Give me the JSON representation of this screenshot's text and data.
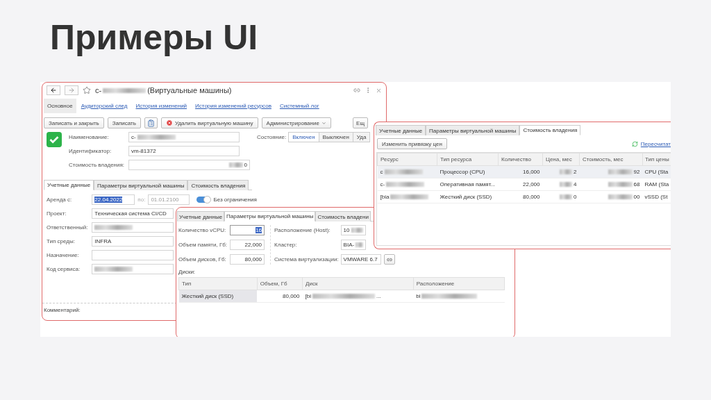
{
  "slide_title": "Примеры UI",
  "main_form": {
    "title": {
      "pre": "c-",
      "masked": true,
      "post": " (Виртуальные машины)"
    },
    "nav": [
      {
        "label": "Основное",
        "selected": true
      },
      {
        "label": "Аудиторский след",
        "selected": false
      },
      {
        "label": "История изменений",
        "selected": false
      },
      {
        "label": "История изменений ресурсов",
        "selected": false
      },
      {
        "label": "Системный лог",
        "selected": false
      }
    ],
    "toolbar": [
      {
        "kind": "button",
        "label": "Записать и закрыть"
      },
      {
        "kind": "button",
        "label": "Записать"
      },
      {
        "kind": "icon"
      },
      {
        "kind": "danger",
        "label": "Удалить виртуальную машину"
      },
      {
        "kind": "menu",
        "label": "Администрирование"
      },
      {
        "kind": "button",
        "label": "Ещ"
      }
    ],
    "fields": [
      {
        "label": "Наименование:",
        "value": {
          "pre": "c-",
          "masked": true
        }
      },
      {
        "label": "Идентификатор:",
        "value": {
          "pre": "vm-81372"
        }
      },
      {
        "label": "Стоимость владения:",
        "value": {
          "masked": true,
          "post": "0"
        },
        "numeric": true
      }
    ],
    "state": {
      "label": "Состояние:",
      "options": [
        {
          "label": "Включен",
          "selected": true
        },
        {
          "label": "Выключен",
          "selected": false
        },
        {
          "label": "Уда",
          "selected": false
        }
      ]
    },
    "tabs": [
      {
        "label": "Учетные данные",
        "selected": true
      },
      {
        "label": "Параметры виртуальной машины",
        "selected": false
      },
      {
        "label": "Стоимость владения",
        "selected": false
      }
    ],
    "rent": {
      "label": "Аренда с:",
      "from": "22.04.2022",
      "to_label": "по:",
      "to": "01.01.2100",
      "toggle_label": "Без ограничения",
      "on": true
    },
    "details": [
      {
        "label": "Проект:",
        "value": {
          "pre": "Техническая система CI/CD"
        }
      },
      {
        "label": "Ответственный:",
        "value": {
          "masked": true
        }
      },
      {
        "label": "Тип среды:",
        "value": {
          "pre": "INFRA"
        }
      },
      {
        "label": "Назначение:"
      },
      {
        "label": "Код сервиса:",
        "value": {
          "masked": true
        }
      }
    ],
    "comment_label": "Комментарий:"
  },
  "vm_params": {
    "tabs": [
      {
        "label": "Учетные данные",
        "selected": false
      },
      {
        "label": "Параметры виртуальной машины",
        "selected": true
      },
      {
        "label": "Стоимость владени",
        "selected": false
      }
    ],
    "left": [
      {
        "label": "Количество vCPU:",
        "value": "16",
        "highlighted": true
      },
      {
        "label": "Объем памяти, Гб:",
        "value": "22,000",
        "highlighted": false
      },
      {
        "label": "Объем дисков, Гб:",
        "value": "80,000",
        "highlighted": false
      }
    ],
    "right": [
      {
        "label": "Расположение (Host):",
        "value": {
          "pre": "10",
          "masked": true
        },
        "kind": "plain"
      },
      {
        "label": "Кластер:",
        "value": {
          "pre": "BIA-",
          "masked": true
        },
        "kind": "plain"
      },
      {
        "label": "Система виртуализации:",
        "value": {
          "pre": "VMWARE 6.7"
        },
        "kind": "link"
      }
    ],
    "disks_label": "Диски:",
    "disks_table": {
      "columns": [
        "Тип",
        "Объем, Гб",
        "Диск",
        "Расположение"
      ],
      "rows": [
        [
          {
            "pre": "Жесткий диск (SSD)"
          },
          {
            "pre": "80,000"
          },
          {
            "pre": "[bi",
            "masked": true,
            "post": " ..."
          },
          {
            "pre": "bi",
            "masked": true
          }
        ]
      ]
    }
  },
  "cost": {
    "tabs": [
      {
        "label": "Учетные данные",
        "selected": false
      },
      {
        "label": "Параметры виртуальной машины",
        "selected": false
      },
      {
        "label": "Стоимость владения",
        "selected": true
      }
    ],
    "button": "Изменить привязку цен",
    "recalc": "Пересчитат",
    "table": {
      "columns": [
        "Ресурс",
        "Тип ресурса",
        "Количество",
        "Цена, мес",
        "Стоимость, мес",
        "Тип цены"
      ],
      "rows": [
        {
          "selected": true,
          "cells": [
            {
              "pre": "c",
              "masked": true
            },
            {
              "pre": "Процессор (CPU)"
            },
            {
              "pre": "16,000"
            },
            {
              "masked": true,
              "post": "2"
            },
            {
              "masked": true,
              "post": "92"
            },
            {
              "pre": "CPU (Sta"
            }
          ]
        },
        {
          "selected": false,
          "cells": [
            {
              "pre": "c-",
              "masked": true
            },
            {
              "pre": "Оперативная памят..."
            },
            {
              "pre": "22,000"
            },
            {
              "masked": true,
              "post": "4"
            },
            {
              "masked": true,
              "post": "68"
            },
            {
              "pre": "RAM (Sta"
            }
          ]
        },
        {
          "selected": false,
          "cells": [
            {
              "pre": "[bia",
              "masked": true
            },
            {
              "pre": "Жесткий диск (SSD)"
            },
            {
              "pre": "80,000"
            },
            {
              "masked": true,
              "post": "0"
            },
            {
              "masked": true,
              "post": "00"
            },
            {
              "pre": "vSSD (St"
            }
          ]
        }
      ]
    }
  }
}
